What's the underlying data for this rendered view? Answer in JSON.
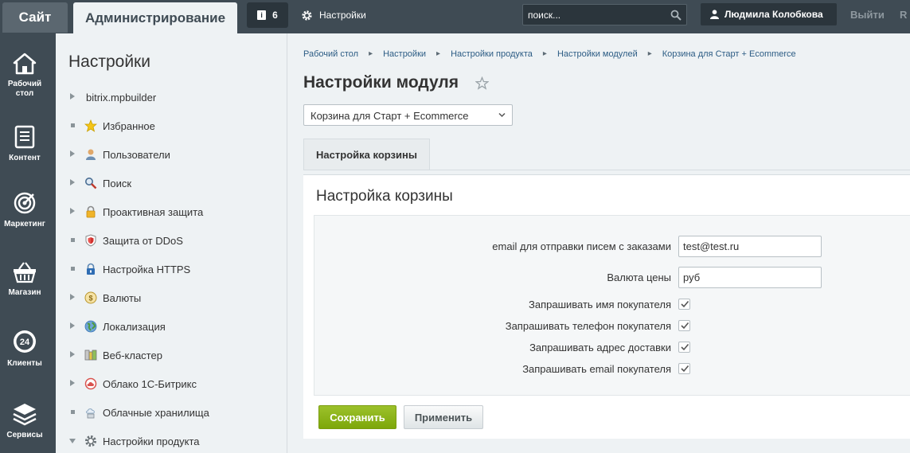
{
  "topbar": {
    "site_label": "Сайт",
    "admin_label": "Администрирование",
    "notifications_count": "6",
    "settings_label": "Настройки",
    "search_placeholder": "поиск...",
    "user_name": "Людмила Колобкова",
    "logout_label": "Выйти",
    "lang_label": "R"
  },
  "leftmenu": {
    "items": [
      {
        "label": "Рабочий стол",
        "icon": "home-icon"
      },
      {
        "label": "Контент",
        "icon": "document-icon"
      },
      {
        "label": "Маркетинг",
        "icon": "target-icon"
      },
      {
        "label": "Магазин",
        "icon": "basket-icon"
      },
      {
        "label": "Клиенты",
        "icon": "clock-24-icon",
        "badge": "24"
      },
      {
        "label": "Сервисы",
        "icon": "layers-icon"
      }
    ]
  },
  "tree": {
    "title": "Настройки",
    "items": [
      {
        "label": "bitrix.mpbuilder",
        "marker": "arrow"
      },
      {
        "label": "Избранное",
        "marker": "dot",
        "icon": "star-icon"
      },
      {
        "label": "Пользователи",
        "marker": "arrow",
        "icon": "user-icon"
      },
      {
        "label": "Поиск",
        "marker": "arrow",
        "icon": "search-icon"
      },
      {
        "label": "Проактивная защита",
        "marker": "arrow",
        "icon": "lock-icon"
      },
      {
        "label": "Защита от DDoS",
        "marker": "dot",
        "icon": "shield-icon"
      },
      {
        "label": "Настройка HTTPS",
        "marker": "dot",
        "icon": "https-lock-icon"
      },
      {
        "label": "Валюты",
        "marker": "arrow",
        "icon": "coin-icon"
      },
      {
        "label": "Локализация",
        "marker": "arrow",
        "icon": "globe-icon"
      },
      {
        "label": "Веб-кластер",
        "marker": "arrow",
        "icon": "server-icon"
      },
      {
        "label": "Облако 1С-Битрикс",
        "marker": "arrow",
        "icon": "cloud-icon"
      },
      {
        "label": "Облачные хранилища",
        "marker": "dot",
        "icon": "cloud-storage-icon"
      },
      {
        "label": "Настройки продукта",
        "marker": "arrow-down",
        "icon": "gear-icon"
      }
    ]
  },
  "breadcrumbs": [
    "Рабочий стол",
    "Настройки",
    "Настройки продукта",
    "Настройки модулей",
    "Корзина для Старт + Ecommerce"
  ],
  "page": {
    "title": "Настройки модуля",
    "module_select_value": "Корзина для Старт + Ecommerce",
    "tab_label": "Настройка корзины",
    "card_title": "Настройка корзины"
  },
  "form": {
    "email_label": "email для отправки писем с заказами",
    "email_value": "test@test.ru",
    "currency_label": "Валюта цены",
    "currency_value": "руб",
    "checkboxes": [
      {
        "label": "Запрашивать имя покупателя",
        "checked": true
      },
      {
        "label": "Запрашивать телефон покупателя",
        "checked": true
      },
      {
        "label": "Запрашивать адрес доставки",
        "checked": true
      },
      {
        "label": "Запрашивать email покупателя",
        "checked": true
      }
    ]
  },
  "buttons": {
    "save_label": "Сохранить",
    "apply_label": "Применить"
  },
  "colors": {
    "topbar": "#3f4b54",
    "save_button": "#86ad00",
    "link": "#2c5c84"
  }
}
